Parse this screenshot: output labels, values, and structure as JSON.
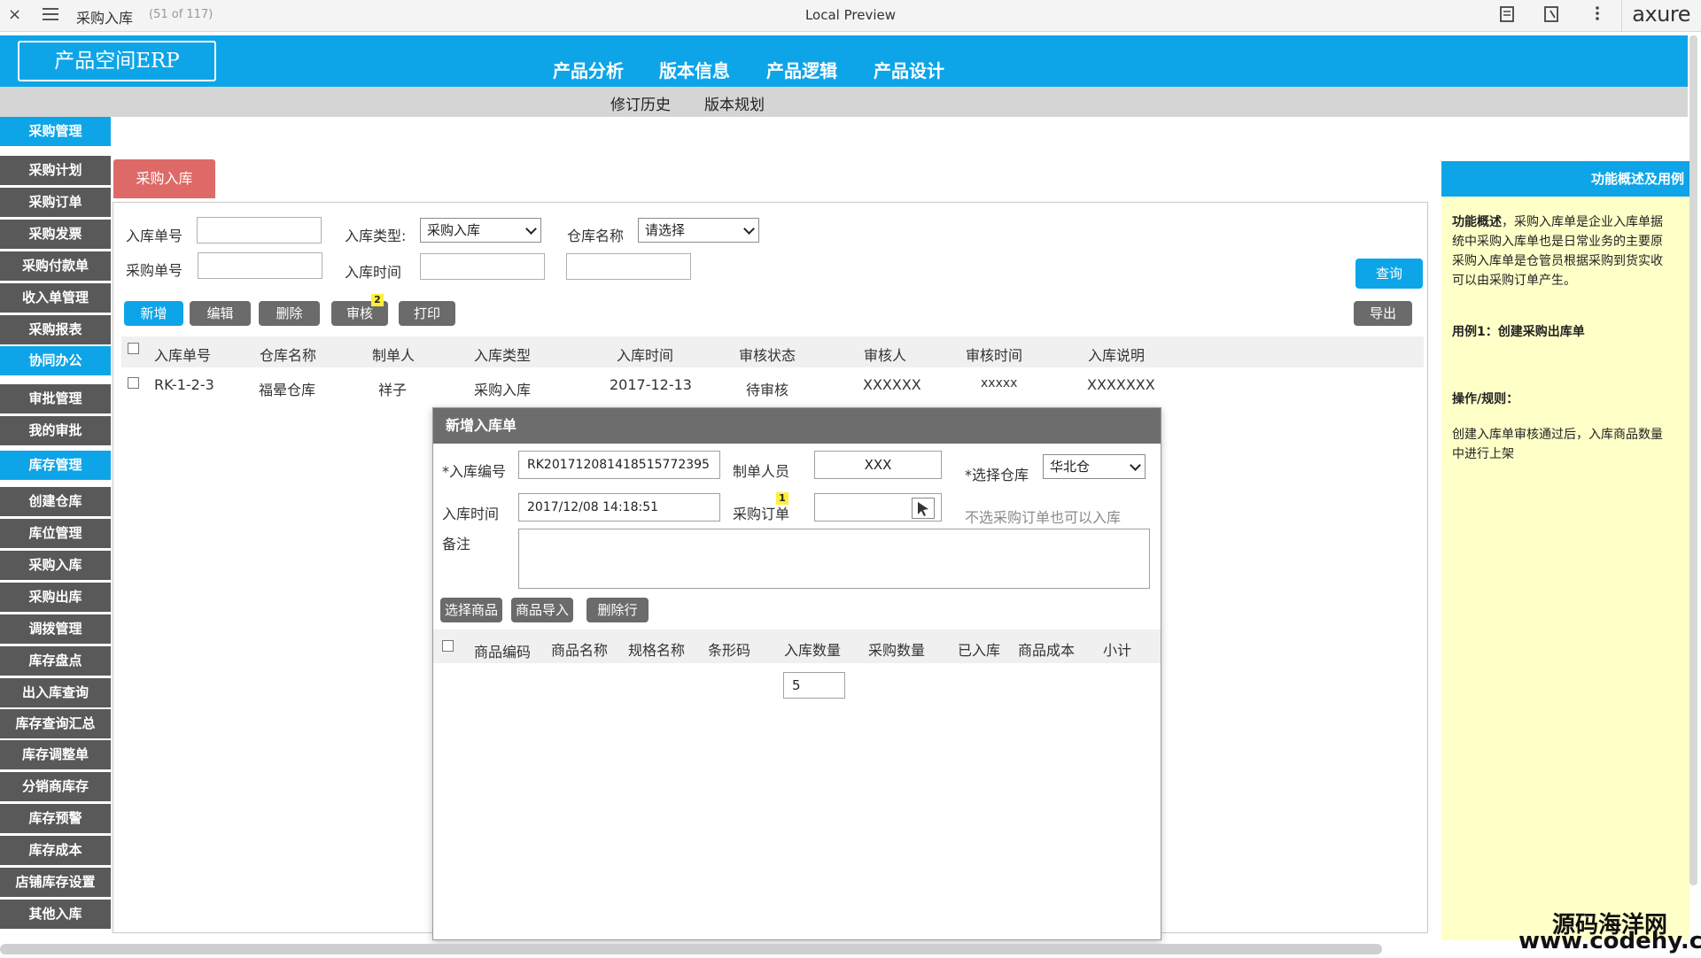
{
  "toolbar": {
    "close": "×",
    "page_title": "采购入库",
    "page_count": "(51 of 117)",
    "center_title": "Local Preview",
    "brand": "axure"
  },
  "header": {
    "logo": "产品空间ERP",
    "nav": [
      "产品分析",
      "版本信息",
      "产品逻辑",
      "产品设计"
    ],
    "subnav": [
      "修订历史",
      "版本规划"
    ]
  },
  "sidebar": {
    "items": [
      {
        "label": "采购管理",
        "type": "head"
      },
      {
        "label": "采购计划",
        "type": "item"
      },
      {
        "label": "采购订单",
        "type": "item"
      },
      {
        "label": "采购发票",
        "type": "item"
      },
      {
        "label": "采购付款单",
        "type": "item"
      },
      {
        "label": "收入单管理",
        "type": "item"
      },
      {
        "label": "采购报表",
        "type": "item"
      },
      {
        "label": "协同办公",
        "type": "head"
      },
      {
        "label": "审批管理",
        "type": "item"
      },
      {
        "label": "我的审批",
        "type": "item"
      },
      {
        "label": "库存管理",
        "type": "head"
      },
      {
        "label": "创建仓库",
        "type": "item"
      },
      {
        "label": "库位管理",
        "type": "item"
      },
      {
        "label": "采购入库",
        "type": "item"
      },
      {
        "label": "采购出库",
        "type": "item"
      },
      {
        "label": "调拨管理",
        "type": "item"
      },
      {
        "label": "库存盘点",
        "type": "item"
      },
      {
        "label": "出入库查询",
        "type": "item"
      },
      {
        "label": "库存查询汇总",
        "type": "item"
      },
      {
        "label": "库存调整单",
        "type": "item"
      },
      {
        "label": "分销商库存",
        "type": "item"
      },
      {
        "label": "库存预警",
        "type": "item"
      },
      {
        "label": "库存成本",
        "type": "item"
      },
      {
        "label": "店铺库存设置",
        "type": "item"
      },
      {
        "label": "其他入库",
        "type": "item"
      }
    ]
  },
  "tab": {
    "label": "采购入库"
  },
  "filters": {
    "inbound_no_label": "入库单号",
    "inbound_no_value": "",
    "inbound_type_label": "入库类型:",
    "inbound_type_value": "采购入库",
    "warehouse_label": "仓库名称",
    "warehouse_value": "请选择",
    "purchase_no_label": "采购单号",
    "purchase_no_value": "",
    "inbound_time_label": "入库时间",
    "time_from": "",
    "time_to": "",
    "query_button": "查询"
  },
  "actions": {
    "add": "新增",
    "edit": "编辑",
    "delete": "删除",
    "audit": "审核",
    "audit_badge": "2",
    "print": "打印",
    "export": "导出"
  },
  "table": {
    "columns": [
      "入库单号",
      "仓库名称",
      "制单人",
      "入库类型",
      "入库时间",
      "审核状态",
      "审核人",
      "审核时间",
      "入库说明"
    ],
    "rows": [
      [
        "RK-1-2-3",
        "福晕仓库",
        "祥子",
        "采购入库",
        "2017-12-13",
        "待审核",
        "XXXXXX",
        "xxxxx",
        "XXXXXXX"
      ]
    ]
  },
  "modal": {
    "title": "新增入库单",
    "inbound_code_label": "*入库编号",
    "inbound_code_value": "RK20171208141851577239​5",
    "creator_label": "制单人员",
    "creator_value": "XXX",
    "warehouse_label": "*选择仓库",
    "warehouse_value": "华北仓",
    "time_label": "入库时间",
    "time_value": "2017/12/08 14:18:51",
    "order_label": "采购订单",
    "order_badge": "1",
    "order_value": "",
    "order_hint": "不选采购订单也可以入库",
    "remark_label": "备注",
    "remark_value": "",
    "btn_select": "选择商品",
    "btn_import": "商品导入",
    "btn_delete_row": "删除行",
    "columns": [
      "商品编码",
      "商品名称",
      "规格名称",
      "条形码",
      "入库数量",
      "采购数量",
      "已入库",
      "商品成本",
      "小计"
    ],
    "qty_value": "5"
  },
  "right_panel": {
    "title": "功能概述及用例",
    "lines": [
      {
        "text": "功能概述，采购入库单是企业入库单据",
        "bold_prefix": "功能概述"
      },
      {
        "text": "统中采购入库单也是日常业务的主要原"
      },
      {
        "text": "采购入库单是仓管员根据采购到货实收"
      },
      {
        "text": "可以由采购订单产生。"
      }
    ],
    "case1": "用例1：创建采购出库单",
    "rules_title": "操作/规则：",
    "rules_lines": [
      "创建入库单审核通过后，入库商品数量",
      "中进行上架"
    ]
  },
  "watermark": {
    "line1": "源码海洋网",
    "line2": "www.codehy.com"
  }
}
